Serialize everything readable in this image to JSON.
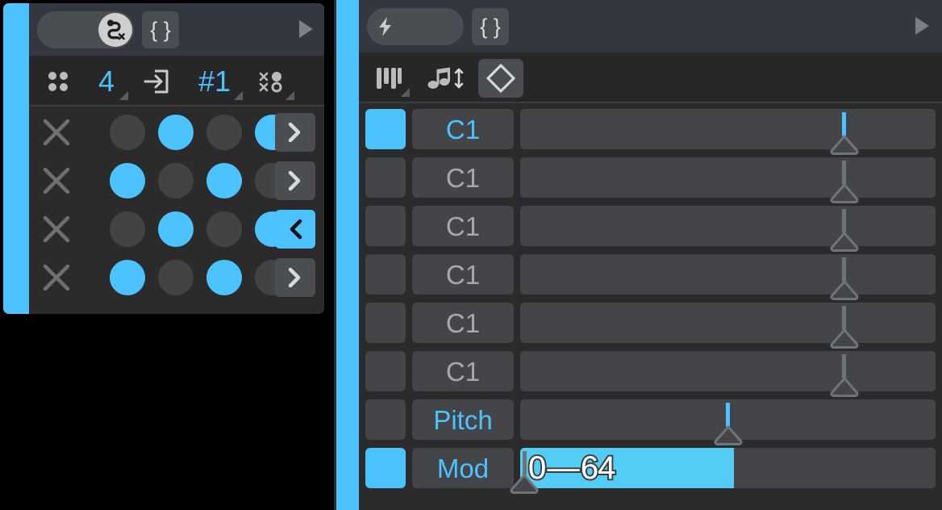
{
  "theme": {
    "accent": "#4cc2ff",
    "panel_bg": "#2b2b2b",
    "topbar_bg": "#343740",
    "toolbar_bg": "#272727",
    "control_bg": "#4a4d52",
    "track_bg": "#434548",
    "dot_off": "#434343",
    "page_bg": "#000000",
    "text_muted": "#a8a8a8"
  },
  "left_panel": {
    "topbar": {
      "toggle": {
        "name": "snake-break-toggle",
        "state": "on",
        "icon": "snake-path-x-icon"
      },
      "braces_button": {
        "label": "{ }",
        "name": "braces-button"
      },
      "play_button": {
        "name": "play-icon"
      }
    },
    "toolbar": [
      {
        "name": "four-dots-grid-icon",
        "type": "icon",
        "label": "",
        "has_corner": false
      },
      {
        "name": "step-count-value",
        "type": "value",
        "label": "4",
        "has_corner": true
      },
      {
        "name": "enter-arrow-box-icon",
        "type": "icon",
        "label": "",
        "has_corner": false
      },
      {
        "name": "pattern-number-value",
        "type": "value",
        "label": "#1",
        "has_corner": true
      },
      {
        "name": "random-dots-icon",
        "type": "icon",
        "label": "",
        "has_corner": true
      }
    ],
    "grid": {
      "columns": 4,
      "rows": [
        {
          "name": "grid-row-1",
          "clear_label": "✕",
          "steps": [
            false,
            true,
            false,
            true
          ],
          "direction": "forward",
          "direction_selected": false
        },
        {
          "name": "grid-row-2",
          "clear_label": "✕",
          "steps": [
            true,
            false,
            true,
            false
          ],
          "direction": "forward",
          "direction_selected": false
        },
        {
          "name": "grid-row-3",
          "clear_label": "✕",
          "steps": [
            false,
            true,
            false,
            true
          ],
          "direction": "backward",
          "direction_selected": true
        },
        {
          "name": "grid-row-4",
          "clear_label": "✕",
          "steps": [
            true,
            false,
            true,
            false
          ],
          "direction": "forward",
          "direction_selected": false
        }
      ]
    }
  },
  "right_panel": {
    "topbar": {
      "toggle": {
        "name": "lightning-toggle",
        "state": "off",
        "icon": "lightning-bolt-icon"
      },
      "braces_button": {
        "label": "{ }",
        "name": "braces-button"
      },
      "play_button": {
        "name": "play-icon"
      }
    },
    "toolbar": [
      {
        "name": "piano-keys-icon",
        "type": "icon",
        "has_corner": true,
        "selected": false
      },
      {
        "name": "note-updown-icon",
        "type": "icon",
        "has_corner": false,
        "selected": false
      },
      {
        "name": "diamond-icon",
        "type": "icon",
        "has_corner": false,
        "selected": true
      }
    ],
    "lanes": [
      {
        "name": "lane-note-1",
        "label": "C1",
        "active": true,
        "label_accent": true,
        "stem_pos": 0.78,
        "stem_blue": true,
        "fill": 0,
        "range_text": ""
      },
      {
        "name": "lane-note-2",
        "label": "C1",
        "active": false,
        "label_accent": false,
        "stem_pos": 0.78,
        "stem_blue": false,
        "fill": 0,
        "range_text": ""
      },
      {
        "name": "lane-note-3",
        "label": "C1",
        "active": false,
        "label_accent": false,
        "stem_pos": 0.78,
        "stem_blue": false,
        "fill": 0,
        "range_text": ""
      },
      {
        "name": "lane-note-4",
        "label": "C1",
        "active": false,
        "label_accent": false,
        "stem_pos": 0.78,
        "stem_blue": false,
        "fill": 0,
        "range_text": ""
      },
      {
        "name": "lane-note-5",
        "label": "C1",
        "active": false,
        "label_accent": false,
        "stem_pos": 0.78,
        "stem_blue": false,
        "fill": 0,
        "range_text": ""
      },
      {
        "name": "lane-note-6",
        "label": "C1",
        "active": false,
        "label_accent": false,
        "stem_pos": 0.78,
        "stem_blue": false,
        "fill": 0,
        "range_text": ""
      },
      {
        "name": "lane-pitch",
        "label": "Pitch",
        "active": false,
        "label_accent": true,
        "stem_pos": 0.5,
        "stem_blue": true,
        "fill": 0,
        "range_text": ""
      },
      {
        "name": "lane-mod",
        "label": "Mod",
        "active": true,
        "label_accent": true,
        "stem_pos": 0.01,
        "stem_blue": false,
        "fill": 0.515,
        "range_text": "0 — 64"
      }
    ]
  }
}
